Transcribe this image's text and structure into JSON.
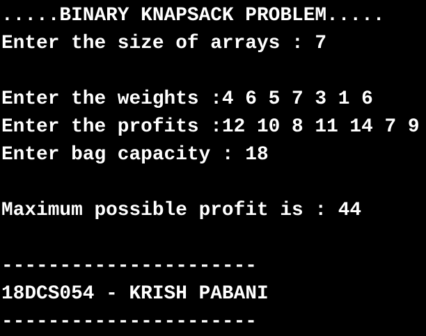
{
  "terminal": {
    "background": "#000000",
    "foreground": "#ffffff",
    "lines": {
      "title": ".....BINARY KNAPSACK PROBLEM.....",
      "size_prompt": "Enter the size of arrays : 7",
      "weights_prompt": "Enter the weights :4 6 5 7 3 1 6",
      "profits_prompt": "Enter the profits :12 10 8 11 14 7 9",
      "capacity_prompt": "Enter bag capacity : 18",
      "result": "Maximum possible profit is : 44",
      "separator_top": "----------------------",
      "author": "18DCS054 - KRISH PABANI",
      "separator_bottom": "----------------------"
    }
  }
}
